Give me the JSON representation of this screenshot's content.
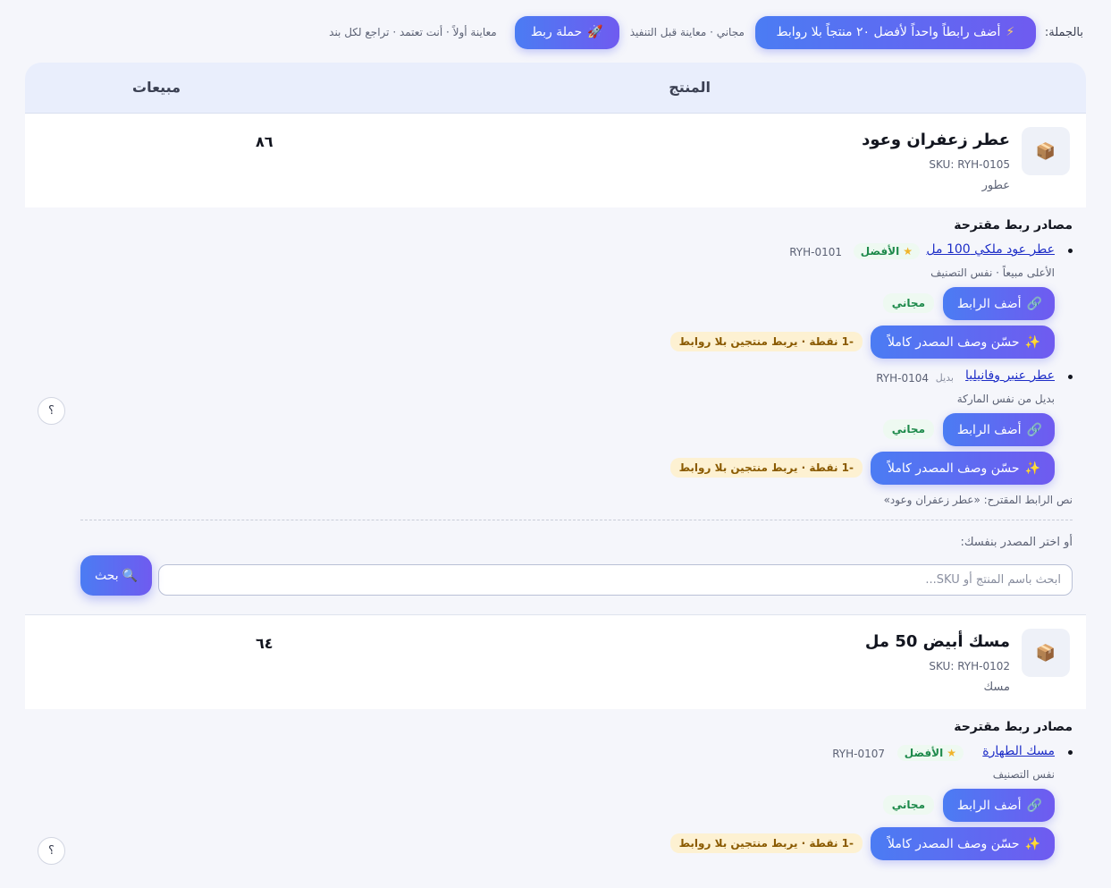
{
  "topbar": {
    "bulk_label": "بالجملة:",
    "bulk_button": "أضف رابطاً واحداً لأفضل ٢٠ منتجاً بلا روابط",
    "bulk_note": "مجاني · معاينة قبل التنفيذ",
    "campaign_button": "حملة ربط",
    "campaign_note": "معاينة أولاً · أنت تعتمد · تراجع لكل بند"
  },
  "table": {
    "col_product": "المنتج",
    "col_sales": "مبيعات"
  },
  "products": [
    {
      "name": "عطر زعفران وعود",
      "sku": "SKU: RYH-0105",
      "category": "عطور",
      "sales": "٨٦",
      "suggestions_title": "مصادر ربط مقترحة",
      "items": [
        {
          "link": "عطر عود ملكي 100 مل",
          "badge": "الأفضل",
          "sku": "RYH-0101",
          "reason": "الأعلى مبيعاً · نفس التصنيف",
          "add": "أضف الرابط",
          "free": "مجاني",
          "enhance": "حسّن وصف المصدر كاملاً",
          "points": "-1 نقطة · يربط منتجين بلا روابط"
        },
        {
          "link": "عطر عنبر وفانيليا",
          "alt": "بديل",
          "sku": "RYH-0104",
          "reason": "بديل من نفس الماركة",
          "add": "أضف الرابط",
          "free": "مجاني",
          "enhance": "حسّن وصف المصدر كاملاً",
          "points": "-1 نقطة · يربط منتجين بلا روابط"
        }
      ],
      "anchor_text": "نص الرابط المقترح: «عطر زعفران وعود»",
      "pick_label": "أو اختر المصدر بنفسك:",
      "search_placeholder": "ابحث باسم المنتج أو SKU...",
      "search_button": "بحث",
      "help": "؟"
    },
    {
      "name": "مسك أبيض 50 مل",
      "sku": "SKU: RYH-0102",
      "category": "مسك",
      "sales": "٦٤",
      "suggestions_title": "مصادر ربط مقترحة",
      "items": [
        {
          "link": "مسك الطهارة",
          "badge": "الأفضل",
          "sku": "RYH-0107",
          "reason": "نفس التصنيف",
          "add": "أضف الرابط",
          "free": "مجاني",
          "enhance": "حسّن وصف المصدر كاملاً",
          "points": "-1 نقطة · يربط منتجين بلا روابط"
        }
      ],
      "help": "؟"
    }
  ]
}
